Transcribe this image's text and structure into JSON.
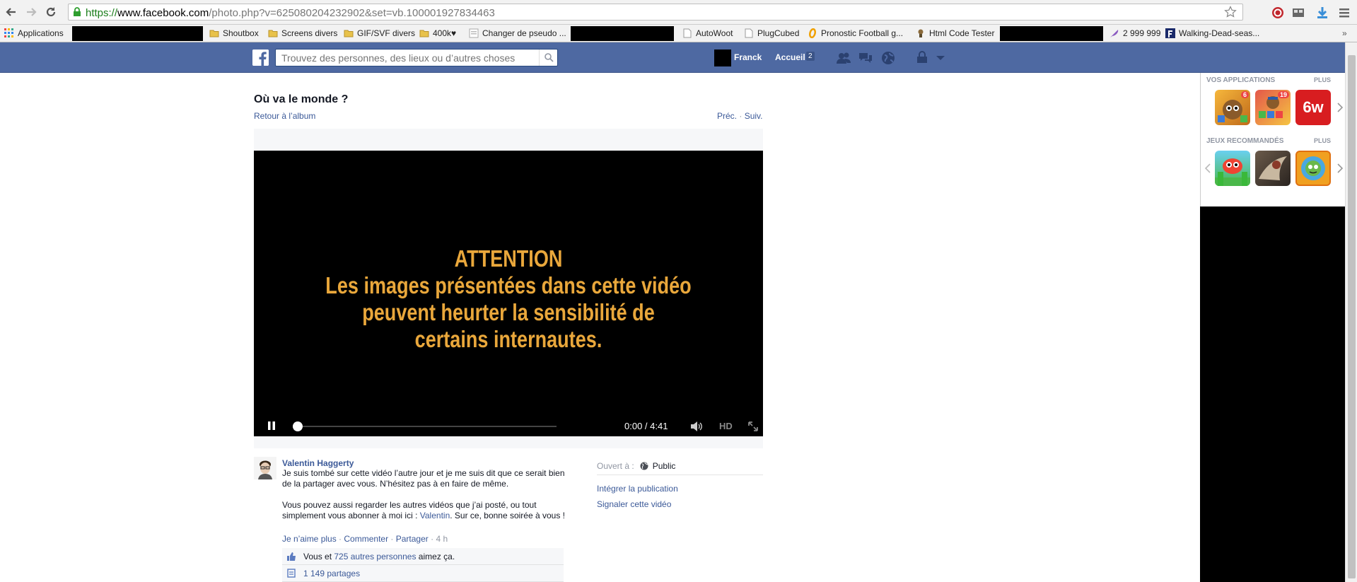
{
  "browser": {
    "url_scheme": "https://",
    "url_host": "www.facebook.com",
    "url_path": "/photo.php?v=625080204232902&set=vb.100001927834463",
    "bookmarks": [
      {
        "label": "Applications",
        "icon": "apps-grid-icon"
      },
      {
        "label": "Shoutbox",
        "icon": "folder-icon"
      },
      {
        "label": "Screens divers",
        "icon": "folder-icon"
      },
      {
        "label": "GIF/SVF divers",
        "icon": "folder-icon"
      },
      {
        "label": "400k♥",
        "icon": "folder-icon"
      },
      {
        "label": "Changer de pseudo ...",
        "icon": "page-icon"
      },
      {
        "label": "AutoWoot",
        "icon": "page-icon"
      },
      {
        "label": "PlugCubed",
        "icon": "page-icon"
      },
      {
        "label": "Pronostic Football g...",
        "icon": "o-logo-icon"
      },
      {
        "label": "Html Code Tester",
        "icon": "tester-icon"
      },
      {
        "label": "2 999 999",
        "icon": "feather-icon"
      },
      {
        "label": "Walking-Dead-seas...",
        "icon": "f-logo-icon"
      }
    ]
  },
  "facebook": {
    "search_placeholder": "Trouvez des personnes, des lieux ou d’autres choses",
    "user_name": "Franck",
    "home_label": "Accueil",
    "home_count": "2",
    "colors": {
      "bar": "#4e69a2",
      "link": "#3b5998"
    }
  },
  "content": {
    "title": "Où va le monde ?",
    "back_label": "Retour à l’album",
    "prev_label": "Préc.",
    "separator": "·",
    "next_label": "Suiv.",
    "video": {
      "warning_title": "ATTENTION",
      "warning_lines": [
        "Les images présentées dans cette vidéo",
        "peuvent heurter la sensibilité de",
        "certains internautes."
      ],
      "time": "0:00 / 4:41",
      "hd_label": "HD",
      "progress": 0
    },
    "post": {
      "author": "Valentin Haggerty",
      "paragraph1": "Je suis tombé sur cette vidéo l’autre jour et je me suis dit que ce serait bien de la partager avec vous. N’hésitez pas à en faire de même.",
      "paragraph2_start": "Vous pouvez aussi regarder les autres vidéos que j’ai posté, ou tout simplement vous abonner à moi ici : ",
      "paragraph2_link": "Valentin",
      "paragraph2_end": ". Sur ce, bonne soirée à vous !",
      "action_unlike": "Je n’aime plus",
      "action_comment": "Commenter",
      "action_share": "Partager",
      "time": "4 h",
      "likes_prefix": "Vous et ",
      "likes_link": "725 autres personnes",
      "likes_suffix": " aimez ça.",
      "shares": "1 149 partages"
    },
    "side": {
      "open_to_label": "Ouvert à :",
      "audience": "Public",
      "embed_label": "Intégrer la publication",
      "report_label": "Signaler cette vidéo"
    }
  },
  "rightcol": {
    "apps_heading": "VOS APPLICATIONS",
    "apps_more": "PLUS",
    "games_heading": "JEUX RECOMMANDÉS",
    "games_more": "PLUS",
    "apps": [
      {
        "name": "app-1",
        "badge": "6"
      },
      {
        "name": "app-2",
        "badge": "19"
      },
      {
        "name": "app-3",
        "badge": "",
        "label": "6w"
      }
    ],
    "games": [
      {
        "name": "game-1"
      },
      {
        "name": "game-2"
      },
      {
        "name": "game-3"
      }
    ]
  }
}
